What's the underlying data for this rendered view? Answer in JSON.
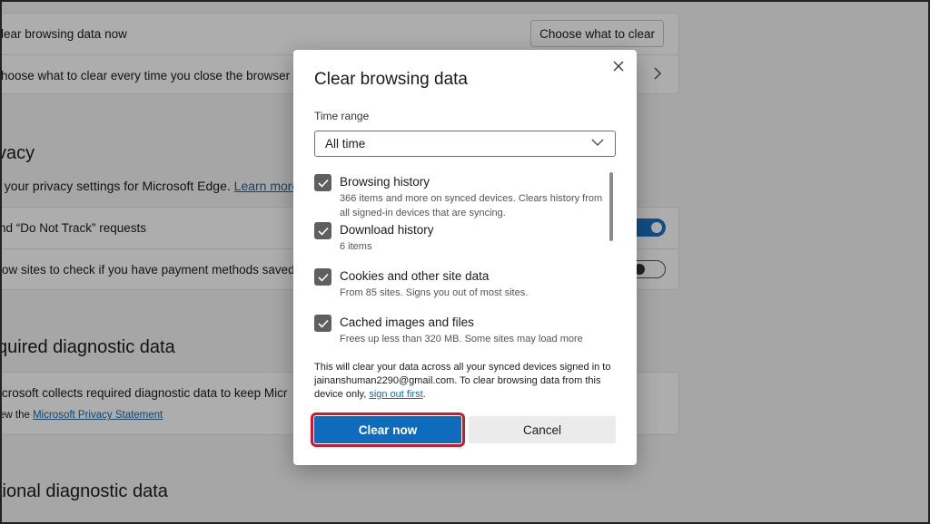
{
  "background": {
    "clear_now_row": {
      "label": "lear browsing data now",
      "button": "Choose what to clear"
    },
    "choose_row": {
      "label": "hoose what to clear every time you close the browser"
    },
    "privacy": {
      "title": "vacy",
      "description": "t your privacy settings for Microsoft Edge. ",
      "learn_more": "Learn more",
      "dnt_label": "nd “Do Not Track” requests",
      "payment_label": "low sites to check if you have payment methods saved"
    },
    "required": {
      "title": "quired diagnostic data",
      "text": "icrosoft collects required diagnostic data to keep Micr",
      "view_prefix": "ew the ",
      "statement_link": "Microsoft Privacy Statement"
    },
    "optional": {
      "title": "tional diagnostic data"
    }
  },
  "dialog": {
    "title": "Clear browsing data",
    "time_range_label": "Time range",
    "time_range_value": "All time",
    "items": [
      {
        "title": "Browsing history",
        "description": "366 items and more on synced devices. Clears history from all signed-in devices that are syncing.",
        "checked": true
      },
      {
        "title": "Download history",
        "description": "6 items",
        "checked": true
      },
      {
        "title": "Cookies and other site data",
        "description": "From 85 sites. Signs you out of most sites.",
        "checked": true
      },
      {
        "title": "Cached images and files",
        "description": "Frees up less than 320 MB. Some sites may load more",
        "checked": true
      }
    ],
    "notice_text": "This will clear your data across all your synced devices signed in to jainanshuman2290@gmail.com. To clear browsing data from this device only, ",
    "sign_out_link": "sign out first",
    "notice_end": ".",
    "clear_button": "Clear now",
    "cancel_button": "Cancel"
  },
  "colors": {
    "accent": "#0f6cbd",
    "highlight": "#d6152a",
    "overlay": "#000000"
  }
}
